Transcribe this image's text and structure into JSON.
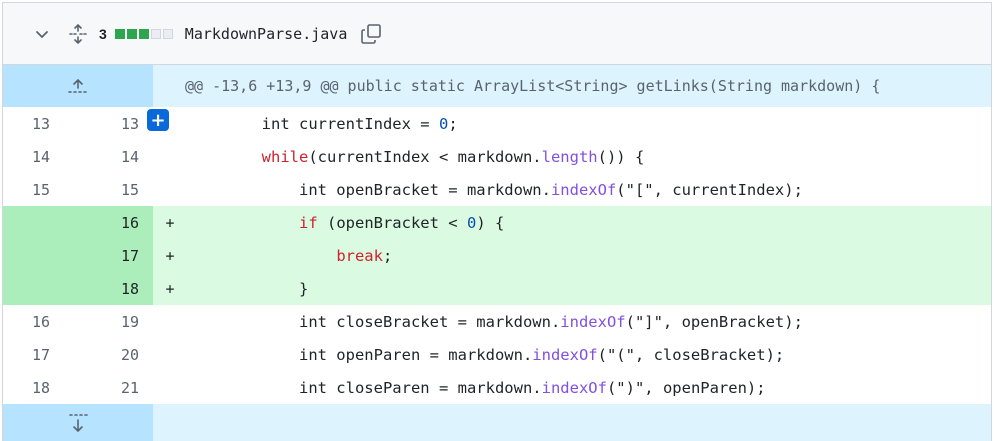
{
  "file": {
    "name": "MarkdownParse.java",
    "diffstat_count": "3",
    "diffstat_blocks": [
      "add",
      "add",
      "add",
      "neutral",
      "neutral"
    ],
    "colors": {
      "add_block": "#2da44e",
      "hunk_bg": "#ddf4ff",
      "added_line_bg": "#dafbe1",
      "added_num_bg": "#aceebb"
    }
  },
  "hunk": {
    "header": "@@ -13,6 +13,9 @@ public static ArrayList<String> getLinks(String markdown) {"
  },
  "lines": [
    {
      "old": "13",
      "new": "13",
      "sign": "",
      "type": "context",
      "tokens": [
        [
          "",
          "        "
        ],
        [
          "",
          "int currentIndex = "
        ],
        [
          "nm",
          "0"
        ],
        [
          "",
          ";"
        ]
      ]
    },
    {
      "old": "14",
      "new": "14",
      "sign": "",
      "type": "context",
      "tokens": [
        [
          "",
          "        "
        ],
        [
          "kw",
          "while"
        ],
        [
          "",
          "(currentIndex < markdown."
        ],
        [
          "fn",
          "length"
        ],
        [
          "",
          "()) {"
        ]
      ]
    },
    {
      "old": "15",
      "new": "15",
      "sign": "",
      "type": "context",
      "tokens": [
        [
          "",
          "            "
        ],
        [
          "",
          "int openBracket = markdown."
        ],
        [
          "fn",
          "indexOf"
        ],
        [
          "",
          "(\"[\", currentIndex);"
        ]
      ]
    },
    {
      "old": "",
      "new": "16",
      "sign": "+",
      "type": "added",
      "tokens": [
        [
          "",
          "            "
        ],
        [
          "kw",
          "if"
        ],
        [
          "",
          " (openBracket < "
        ],
        [
          "nm",
          "0"
        ],
        [
          "",
          ") {"
        ]
      ]
    },
    {
      "old": "",
      "new": "17",
      "sign": "+",
      "type": "added",
      "tokens": [
        [
          "",
          "                "
        ],
        [
          "kw",
          "break"
        ],
        [
          "",
          ";"
        ]
      ]
    },
    {
      "old": "",
      "new": "18",
      "sign": "+",
      "type": "added",
      "tokens": [
        [
          "",
          "            "
        ],
        [
          "",
          "}"
        ]
      ]
    },
    {
      "old": "16",
      "new": "19",
      "sign": "",
      "type": "context",
      "tokens": [
        [
          "",
          "            "
        ],
        [
          "",
          "int closeBracket = markdown."
        ],
        [
          "fn",
          "indexOf"
        ],
        [
          "",
          "(\"]\", openBracket);"
        ]
      ]
    },
    {
      "old": "17",
      "new": "20",
      "sign": "",
      "type": "context",
      "tokens": [
        [
          "",
          "            "
        ],
        [
          "",
          "int openParen = markdown."
        ],
        [
          "fn",
          "indexOf"
        ],
        [
          "",
          "(\"(\", closeBracket);"
        ]
      ]
    },
    {
      "old": "18",
      "new": "21",
      "sign": "",
      "type": "context",
      "tokens": [
        [
          "",
          "            "
        ],
        [
          "",
          "int closeParen = markdown."
        ],
        [
          "fn",
          "indexOf"
        ],
        [
          "",
          "(\")\", openParen);"
        ]
      ]
    }
  ],
  "icons": {
    "collapse": "chevron-down-icon",
    "expand_all": "unfold-icon",
    "copy": "copy-icon",
    "expand_up": "expand-up-icon",
    "expand_down": "expand-down-icon",
    "add_comment": "plus-icon"
  },
  "add_comment_label": "+"
}
